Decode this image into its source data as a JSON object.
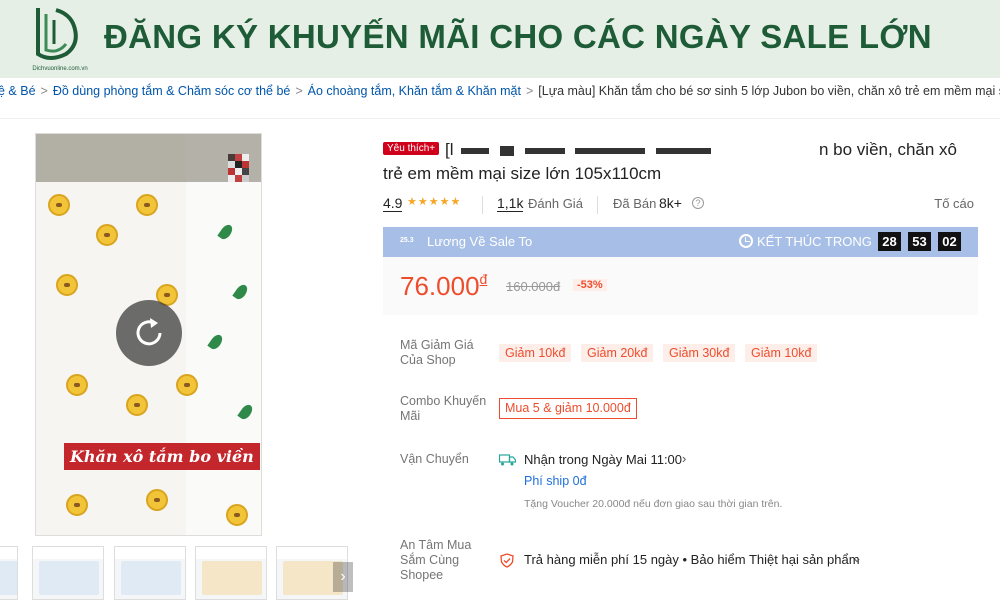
{
  "banner": {
    "logo_text": "Dichvuonline.com.vn",
    "title": "ĐĂNG KÝ KHUYẾN MÃI CHO CÁC NGÀY SALE LỚN",
    "title_color": "#1e5b37",
    "bg_color": "#e6efe6"
  },
  "breadcrumb": [
    "ệ & Bé",
    "Đồ dùng phòng tắm & Chăm sóc cơ thể bé",
    "Áo choàng tắm, Khăn tắm & Khăn mặt",
    "[Lựa màu] Khăn tắm cho bé sơ sinh 5 lớp Jubon bo viền, chăn xô trẻ em mềm mại size."
  ],
  "gallery": {
    "video_caption": "Khăn xô tắm bo viền",
    "replay_icon": "replay-icon",
    "next_icon": "chevron-right-icon"
  },
  "product": {
    "badge": "Yêu thích+",
    "title_line1_start": "[l",
    "title_line1_end": "n bo viền, chăn xô",
    "title_line2": "trẻ em mềm mại size lớn 105x110cm"
  },
  "ratings": {
    "score": "4.9",
    "stars": 5,
    "count": "1,1k",
    "count_label": "Đánh Giá",
    "sold_label": "Đã Bán",
    "sold_value": "8k+",
    "report": "Tố cáo"
  },
  "flash_sale": {
    "tag": "25.3",
    "name": "Lương Về Sale To",
    "ends_label": "KẾT THÚC TRONG",
    "timer": [
      "28",
      "53",
      "02"
    ],
    "bar_color": "#a7bfe6"
  },
  "price": {
    "current": "76.000",
    "currency": "đ",
    "original": "160.000đ",
    "discount": "-53%",
    "accent_color": "#ee4d2d"
  },
  "vouchers": {
    "label": "Mã Giảm Giá Của Shop",
    "items": [
      "Giảm 10kđ",
      "Giảm 20kđ",
      "Giảm 30kđ",
      "Giảm 10kđ"
    ]
  },
  "combo": {
    "label": "Combo Khuyến Mãi",
    "value": "Mua 5 & giảm 10.000đ"
  },
  "shipping": {
    "label": "Vận Chuyển",
    "main": "Nhận trong Ngày Mai 11:00",
    "fee": "Phí ship 0đ",
    "note": "Tặng Voucher 20.000đ nếu đơn giao sau thời gian trên."
  },
  "guarantee": {
    "label": "An Tâm Mua Sắm Cùng Shopee",
    "value": "Trả hàng miễn phí 15 ngày • Bảo hiểm Thiệt hại sản phẩm"
  }
}
